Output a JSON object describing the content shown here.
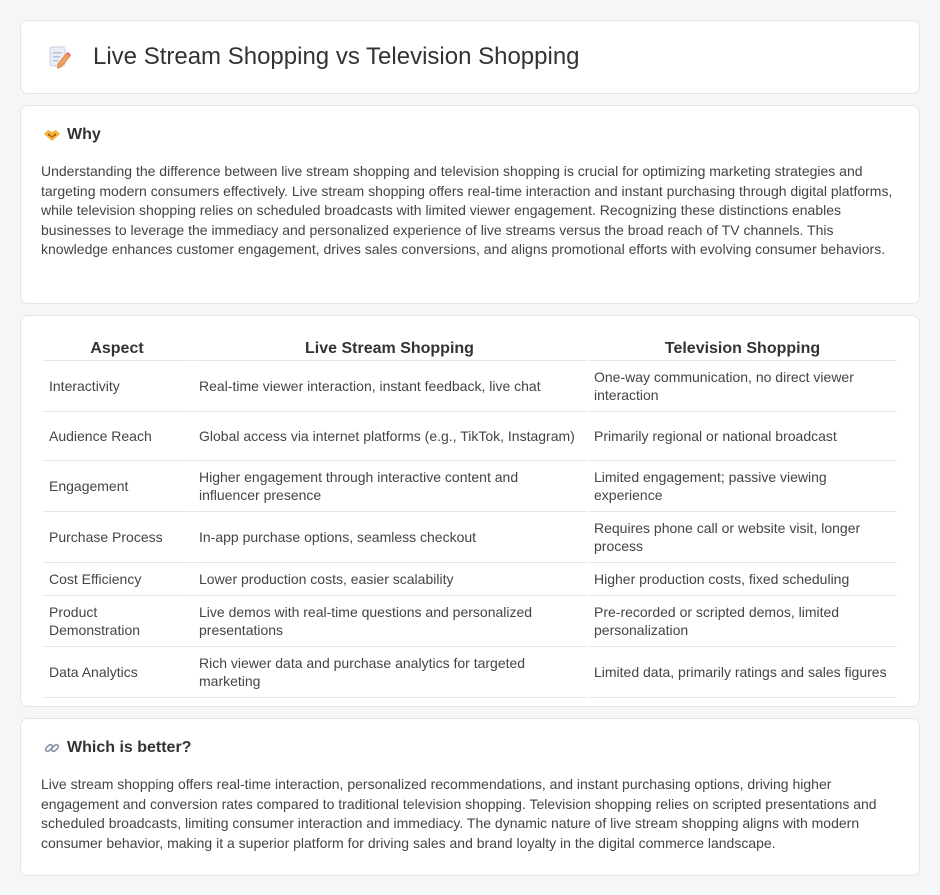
{
  "header": {
    "title": "Live Stream Shopping vs Television Shopping",
    "icon": "document-pencil-icon"
  },
  "why": {
    "heading": "Why",
    "icon": "handshake-icon",
    "text": "Understanding the difference between live stream shopping and television shopping is crucial for optimizing marketing strategies and targeting modern consumers effectively. Live stream shopping offers real-time interaction and instant purchasing through digital platforms, while television shopping relies on scheduled broadcasts with limited viewer engagement. Recognizing these distinctions enables businesses to leverage the immediacy and personalized experience of live streams versus the broad reach of TV channels. This knowledge enhances customer engagement, drives sales conversions, and aligns promotional efforts with evolving consumer behaviors."
  },
  "table": {
    "headers": [
      "Aspect",
      "Live Stream Shopping",
      "Television Shopping"
    ],
    "rows": [
      [
        "Interactivity",
        "Real-time viewer interaction, instant feedback, live chat",
        "One-way communication, no direct viewer interaction"
      ],
      [
        "Audience Reach",
        "Global access via internet platforms (e.g., TikTok, Instagram)",
        "Primarily regional or national broadcast"
      ],
      [
        "Engagement",
        "Higher engagement through interactive content and influencer presence",
        "Limited engagement; passive viewing experience"
      ],
      [
        "Purchase Process",
        "In-app purchase options, seamless checkout",
        "Requires phone call or website visit, longer process"
      ],
      [
        "Cost Efficiency",
        "Lower production costs, easier scalability",
        "Higher production costs, fixed scheduling"
      ],
      [
        "Product Demonstration",
        "Live demos with real-time questions and personalized presentations",
        "Pre-recorded or scripted demos, limited personalization"
      ],
      [
        "Data Analytics",
        "Rich viewer data and purchase analytics for targeted marketing",
        "Limited data, primarily ratings and sales figures"
      ]
    ]
  },
  "better": {
    "heading": "Which is better?",
    "icon": "link-icon",
    "text": "Live stream shopping offers real-time interaction, personalized recommendations, and instant purchasing options, driving higher engagement and conversion rates compared to traditional television shopping. Television shopping relies on scripted presentations and scheduled broadcasts, limiting consumer interaction and immediacy. The dynamic nature of live stream shopping aligns with modern consumer behavior, making it a superior platform for driving sales and brand loyalty in the digital commerce landscape."
  }
}
